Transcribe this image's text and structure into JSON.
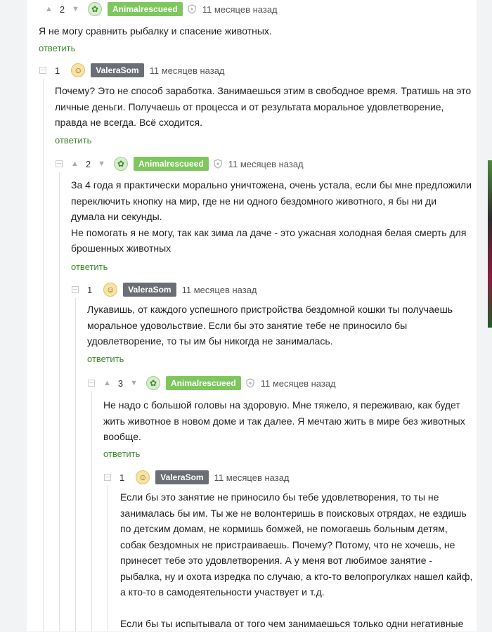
{
  "comments": [
    {
      "rating": "2",
      "author": "Animalrescueed",
      "time": "11 месяцев назад",
      "lines": [
        "Я не могу сравнить рыбалку и спасение животных."
      ],
      "reply": "ответить"
    },
    {
      "rating": "1",
      "author": "ValeraSom",
      "time": "11 месяцев назад",
      "lines": [
        "Почему? Это не способ заработка. Занимаешься этим в свободное время. Тратишь на это",
        "личные деньги. Получаешь от процесса и от результата моральное удовлетворение,",
        "правда не всегда. Всё сходится."
      ],
      "reply": "ответить"
    },
    {
      "rating": "2",
      "author": "Animalrescueed",
      "time": "11 месяцев назад",
      "lines": [
        "За 4 года я практически морально уничтожена, очень устала, если бы мне предложили",
        "переключить кнопку на мир, где не ни одного бездомного животного, я бы ни ди",
        "думала ни секунды.",
        "Не помогать я не могу, так как зима ла даче - это ужасная холодная белая смерть для",
        "брошенных животных"
      ],
      "reply": "ответить"
    },
    {
      "rating": "1",
      "author": "ValeraSom",
      "time": "11 месяцев назад",
      "lines": [
        "Лукавишь, от каждого успешного пристройства бездомной кошки ты получаешь",
        "моральное удовольствие. Если бы это занятие тебе не приносило бы",
        "удовлетворение, то ты им бы никогда не занималась."
      ],
      "reply": "ответить"
    },
    {
      "rating": "3",
      "author": "Animalrescueed",
      "time": "11 месяцев назад",
      "lines": [
        "Не надо с большой головы на здоровую. Мне тяжело, я переживаю, как будет",
        "жить животное в новом доме и так далее. Я мечтаю жить в мире без животных",
        "вообще."
      ],
      "reply": "ответить"
    },
    {
      "rating": "1",
      "author": "ValeraSom",
      "time": "11 месяцев назад",
      "lines": [
        "Если бы это занятие не приносило бы тебе удовлетворения, то ты не",
        "занималась бы им. Ты же не волонтеришь в поисковых отрядах, не ездишь",
        "по детским домам, не кормишь бомжей, не помогаешь больным детям,",
        "собак бездомных не пристраиваешь. Почему? Потому, что не хочешь, не",
        "принесет тебе это удовлетворения. А у меня вот любимое занятие -",
        "рыбалка, ну и охота изредка по случаю, а кто-то велопрогулках нашел кайф,",
        "а кто-то в самодеятельности участвует и т.д.",
        "",
        "Если бы ты испытывала от того чем занимаешься только одни негативные"
      ],
      "reply": ""
    }
  ],
  "ui": {
    "upvote_icon": "arrow-up-icon",
    "downvote_icon": "arrow-down-icon",
    "verified_icon": "shield-icon",
    "accent": "#7ec75d",
    "author_badge_gray": "#6b6f75",
    "link_color": "#3c8a2c"
  }
}
